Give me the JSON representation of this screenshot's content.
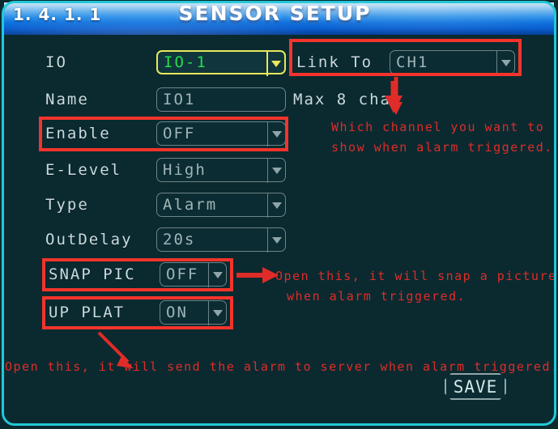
{
  "titlebar": {
    "menu_code": "1. 4. 1. 1",
    "title": "SENSOR  SETUP"
  },
  "colors": {
    "background": "#0a2a30",
    "frame_border": "#22c8d8",
    "title_gradient_top": "#cfe6f7",
    "title_gradient_bottom": "#063f9a",
    "label_text": "#c9dadd",
    "field_text": "#9fb4b8",
    "selected_border": "#e8e85a",
    "selected_text": "#24dd4a",
    "annotation_red": "#e02c28",
    "highlight_box_red": "#f4342c"
  },
  "form": {
    "fields": [
      {
        "label": "IO",
        "value": "IO-1",
        "type": "dropdown",
        "selected": true,
        "highlighted": false
      },
      {
        "label": "Link To",
        "value": "CH1",
        "type": "dropdown",
        "selected": false,
        "highlighted": true
      },
      {
        "label": "Name",
        "value": "IO1",
        "type": "text",
        "selected": false,
        "highlighted": false
      },
      {
        "label": "Enable",
        "value": "OFF",
        "type": "dropdown",
        "selected": false,
        "highlighted": true
      },
      {
        "label": "E-Level",
        "value": "High",
        "type": "dropdown",
        "selected": false,
        "highlighted": false
      },
      {
        "label": "Type",
        "value": "Alarm",
        "type": "dropdown",
        "selected": false,
        "highlighted": false
      },
      {
        "label": "OutDelay",
        "value": "20s",
        "type": "dropdown",
        "selected": false,
        "highlighted": false
      },
      {
        "label": "SNAP PIC",
        "value": "OFF",
        "type": "dropdown",
        "selected": false,
        "highlighted": true
      },
      {
        "label": "UP PLAT",
        "value": "ON",
        "type": "dropdown",
        "selected": false,
        "highlighted": true
      }
    ],
    "name_hint": "Max 8 char",
    "save_label": "SAVE"
  },
  "annotations": [
    {
      "id": "link-to-note",
      "line1": "Which channel you want to",
      "line2": "show when alarm triggered."
    },
    {
      "id": "snap-pic-note",
      "line1": "Open this, it will snap a picture",
      "line2": "when alarm triggered."
    },
    {
      "id": "up-plat-note",
      "line1": "Open this, it will send the alarm to server when alarm triggered.",
      "line2": ""
    }
  ]
}
